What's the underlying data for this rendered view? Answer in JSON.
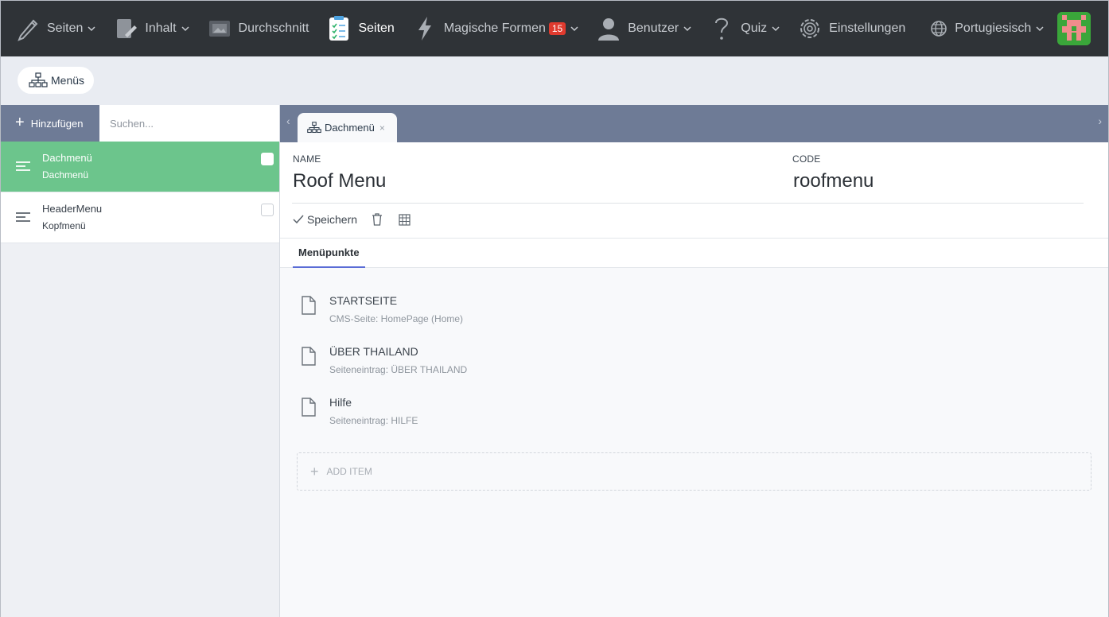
{
  "nav": {
    "items": [
      {
        "label": "Seiten",
        "icon": "pencil-icon",
        "caret": true
      },
      {
        "label": "Inhalt",
        "icon": "content-edit-icon",
        "caret": true
      },
      {
        "label": "Durchschnitt",
        "icon": "media-icon",
        "caret": false
      },
      {
        "label": "Seiten",
        "icon": "clipboard-icon",
        "caret": false,
        "active": true
      },
      {
        "label": "Magische Formen",
        "icon": "lightning-icon",
        "caret": true,
        "badge": "15"
      },
      {
        "label": "Benutzer",
        "icon": "user-icon",
        "caret": true
      },
      {
        "label": "Quiz",
        "icon": "question-icon",
        "caret": true
      },
      {
        "label": "Einstellungen",
        "icon": "gear-icon",
        "caret": false
      },
      {
        "label": "Portugiesisch",
        "icon": "globe-icon",
        "caret": true
      }
    ]
  },
  "breadcrumb": {
    "label": "Menüs"
  },
  "sidebar": {
    "add_label": "Hinzufügen",
    "search_placeholder": "Suchen...",
    "items": [
      {
        "title": "Dachmenü",
        "subtitle": "Dachmenü",
        "active": true
      },
      {
        "title": "HeaderMenu",
        "subtitle": "Kopfmenü",
        "active": false
      }
    ]
  },
  "tab": {
    "label": "Dachmenü",
    "close": "×"
  },
  "form": {
    "name_label": "NAME",
    "name_value": "Roof Menu",
    "code_label": "CODE",
    "code_value": "roofmenu",
    "save_label": "Speichern"
  },
  "subtab": {
    "label": "Menüpunkte"
  },
  "menu_items": [
    {
      "title": "STARTSEITE",
      "subtitle": "CMS-Seite: HomePage (Home)"
    },
    {
      "title": "ÜBER THAILAND",
      "subtitle": "Seiteneintrag: ÜBER THAILAND"
    },
    {
      "title": "Hilfe",
      "subtitle": "Seiteneintrag: HILFE"
    }
  ],
  "add_item": {
    "label": "ADD ITEM"
  },
  "colors": {
    "topbar": "#2f3337",
    "active_item": "#6cc58c",
    "tabstrip": "#6e7b96",
    "badge": "#e03a2e"
  }
}
